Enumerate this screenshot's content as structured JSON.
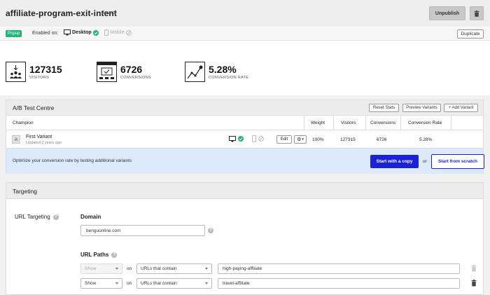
{
  "header": {
    "title": "affiliate-program-exit-intent",
    "saved": "Saved",
    "unpublish": "Unpublish",
    "delete_icon": "trash-icon"
  },
  "subbar": {
    "type_badge": "Popup",
    "enabled_on": "Enabled on:",
    "desktop": "Desktop",
    "mobile": "Mobile",
    "duplicate": "Duplicate"
  },
  "stats": [
    {
      "value": "127315",
      "label": "VISITORS",
      "icon": "visitors-icon"
    },
    {
      "value": "6726",
      "label": "CONVERSIONS",
      "icon": "conversions-icon"
    },
    {
      "value": "5.28%",
      "label": "CONVERSION RATE",
      "icon": "trend-chart-icon"
    }
  ],
  "ab": {
    "title": "A/B Test Centre",
    "reset_stats": "Reset Stats",
    "preview_variants": "Preview Variants",
    "add_variant": "+ Add Variant",
    "columns": {
      "champion": "Champion",
      "weight": "Weight",
      "visitors": "Visitors",
      "conversions": "Conversions",
      "conversion_rate": "Conversion Rate"
    },
    "row": {
      "badge": "A",
      "name": "First Variant",
      "updated": "Updated 2 years ago",
      "edit": "Edit",
      "weight": "100%",
      "visitors": "127315",
      "conversions": "6726",
      "conversion_rate": "5.28%"
    },
    "optimize_text": "Optimize your conversion rate by testing additional variants",
    "start_copy": "Start with a copy",
    "or": "or",
    "start_scratch": "Start from scratch"
  },
  "targeting": {
    "title": "Targeting",
    "url_targeting": "URL Targeting",
    "domain_label": "Domain",
    "domain_value": "benguonline.com",
    "paths_label": "URL Paths",
    "paths": [
      {
        "mode": "Show",
        "on": "on",
        "match": "URLs that contain",
        "value": "high-paying-affiliate",
        "disabled": true
      },
      {
        "mode": "Show",
        "on": "on",
        "match": "URLs that contain",
        "value": "travel-affiliate",
        "disabled": false
      }
    ]
  },
  "colors": {
    "accent_green": "#21b57a",
    "primary_blue": "#1a22d6",
    "info_bg": "#dbe9fb"
  }
}
